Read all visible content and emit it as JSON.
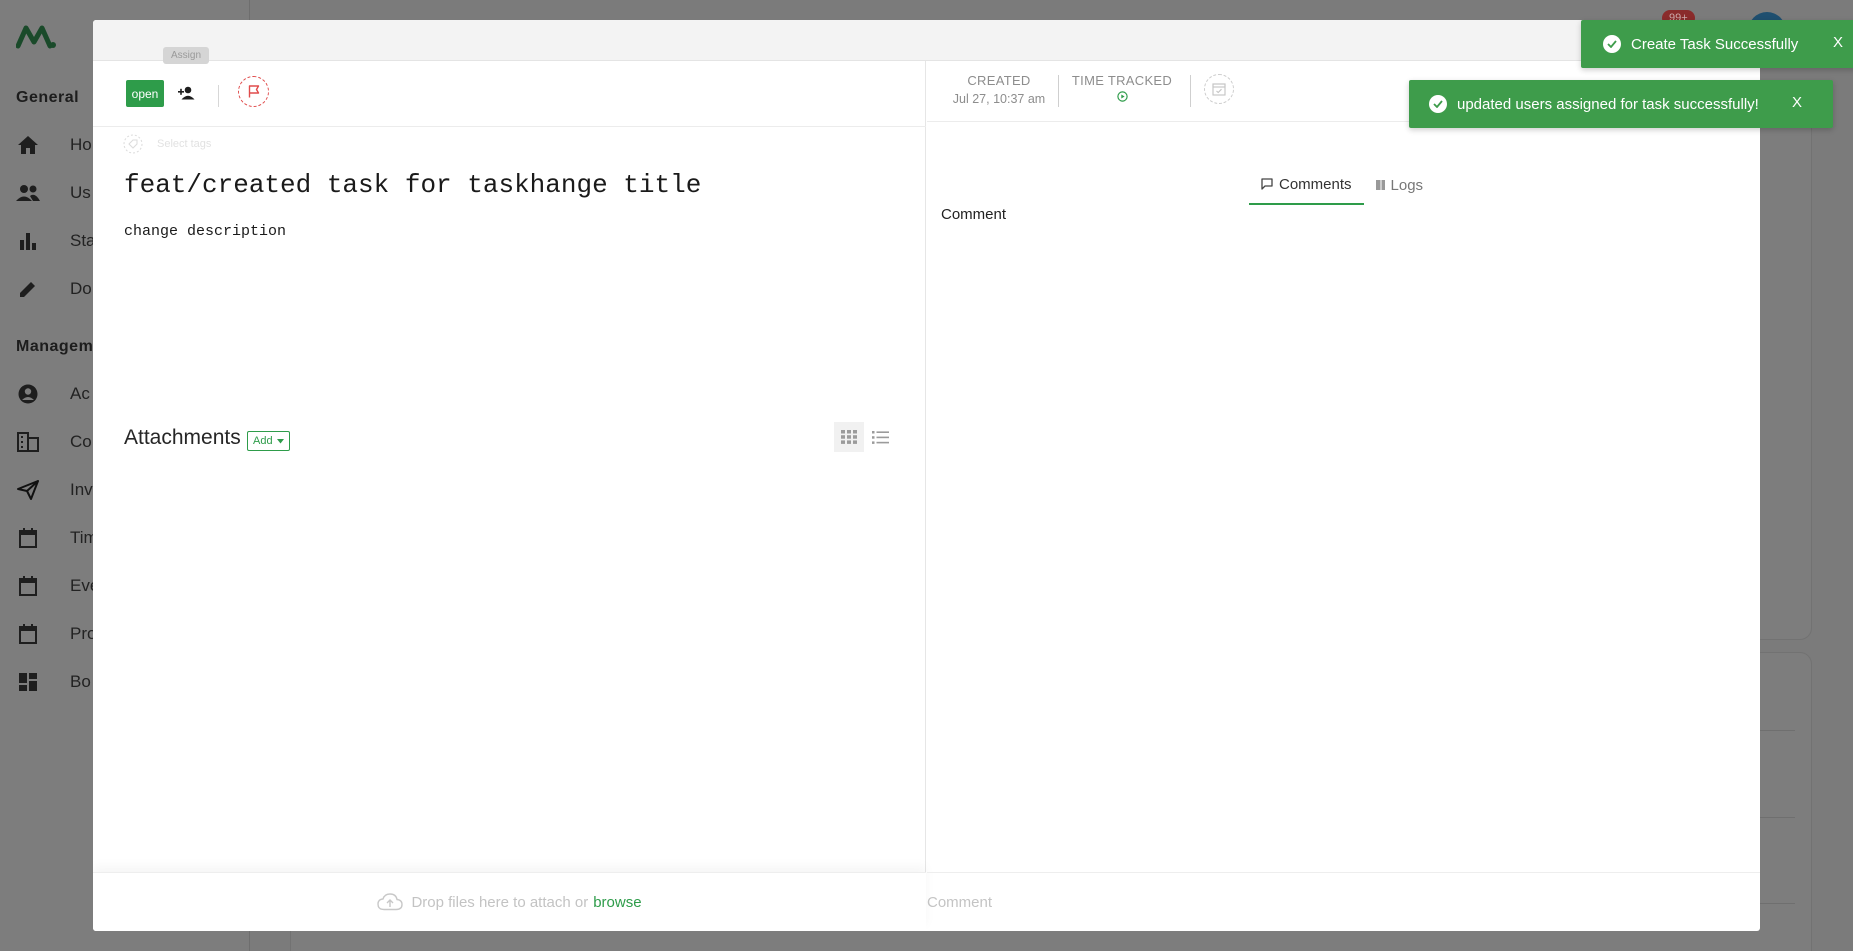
{
  "sidebar": {
    "sections": [
      "General",
      "Manageme"
    ],
    "items": [
      {
        "label": "Ho",
        "icon": "home-icon"
      },
      {
        "label": "Us",
        "icon": "users-icon"
      },
      {
        "label": "Sta",
        "icon": "stats-icon"
      },
      {
        "label": "Do",
        "icon": "pencil-icon"
      },
      {
        "label": "Ac",
        "icon": "account-icon"
      },
      {
        "label": "Co",
        "icon": "company-icon"
      },
      {
        "label": "Inv",
        "icon": "send-icon"
      },
      {
        "label": "Tim",
        "icon": "calendar-icon"
      },
      {
        "label": "Eve",
        "icon": "calendar-icon"
      },
      {
        "label": "Pro",
        "icon": "calendar-icon"
      },
      {
        "label": "Bo",
        "icon": "dashboard-icon"
      }
    ]
  },
  "header": {
    "badge": "99+"
  },
  "task": {
    "status": "open",
    "assign_tooltip": "Assign",
    "title": "feat/created task for taskhange title",
    "description": "change description",
    "tag_placeholder": "Select tags"
  },
  "attachments": {
    "title": "Attachments",
    "add_label": "Add",
    "drop_text": "Drop files here to attach or",
    "browse_label": "browse"
  },
  "meta": {
    "created_label": "CREATED",
    "created_value": "Jul 27, 10:37 am",
    "time_tracked_label": "TIME TRACKED"
  },
  "tabs": [
    {
      "label": "Comments",
      "active": true
    },
    {
      "label": "Logs",
      "active": false
    }
  ],
  "comments": {
    "section_label": "Comment",
    "input_placeholder": "Comment"
  },
  "toasts": [
    {
      "message": "Create Task Successfully",
      "close": "X"
    },
    {
      "message": "updated users assigned for task successfully!",
      "close": "X"
    }
  ],
  "colors": {
    "accent": "#2e9c4a",
    "priority": "#e04c4c",
    "toast_bg": "#3e9c4b"
  }
}
